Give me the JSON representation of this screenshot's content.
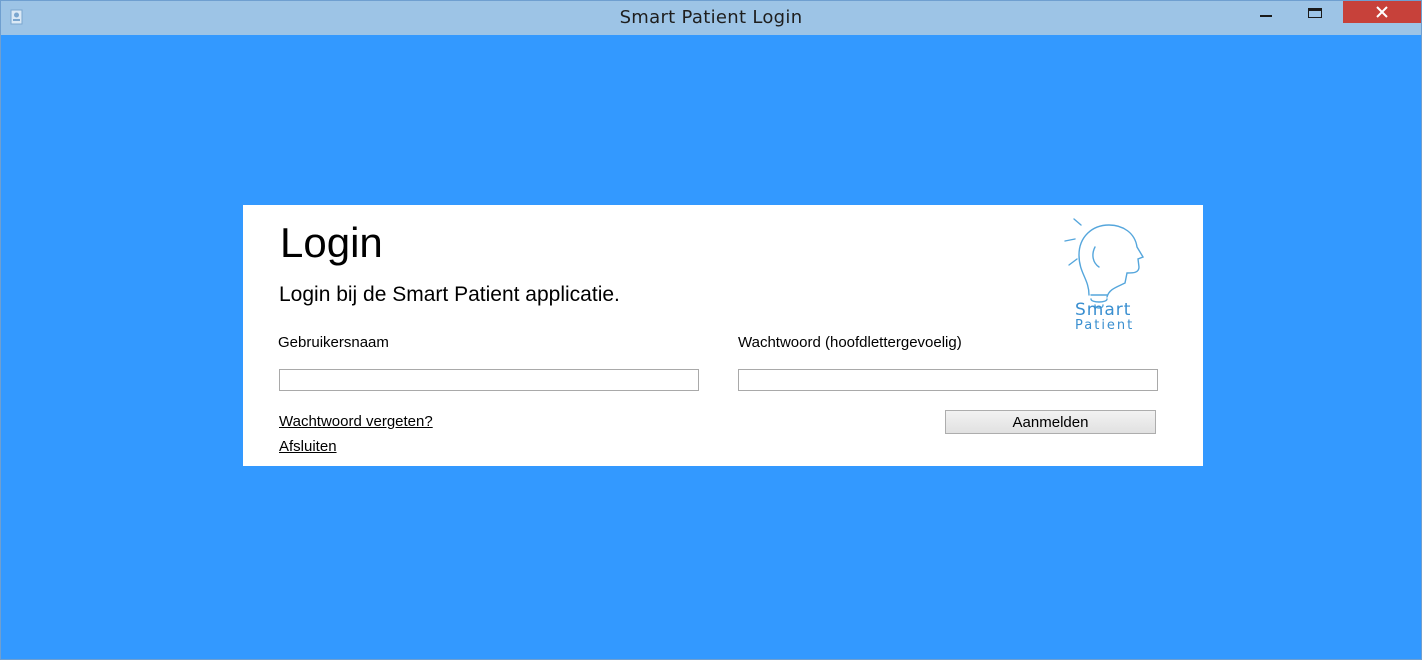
{
  "window": {
    "title": "Smart Patient Login",
    "icon": "app-icon",
    "controls": [
      "minimize-icon",
      "maximize-icon",
      "close-icon"
    ],
    "close_color": "#c7413a"
  },
  "background_color": "#3399ff",
  "login": {
    "heading": "Login",
    "subheading": "Login bij de Smart Patient applicatie.",
    "username_label": "Gebruikersnaam",
    "username_value": "",
    "password_label": "Wachtwoord (hoofdlettergevoelig)",
    "password_value": "",
    "forgot_link": "Wachtwoord vergeten?",
    "exit_link": "Afsluiten",
    "submit_label": "Aanmelden"
  },
  "logo": {
    "icon": "lightbulb-head-icon",
    "line1": "Smart",
    "line2": "Patient",
    "color": "#3a8fd0"
  }
}
